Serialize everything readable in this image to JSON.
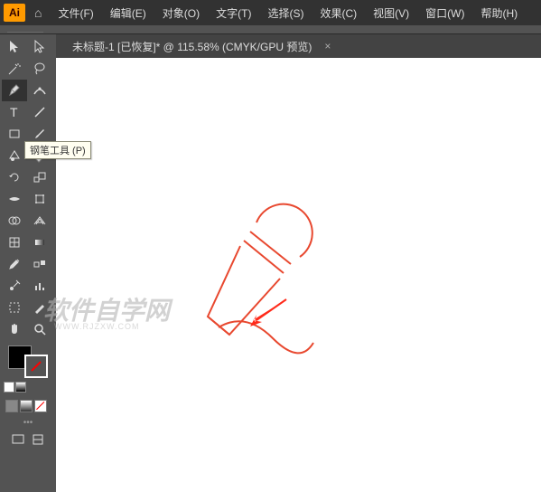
{
  "app": {
    "logo": "Ai"
  },
  "menu": {
    "file": "文件(F)",
    "edit": "编辑(E)",
    "object": "对象(O)",
    "type": "文字(T)",
    "select": "选择(S)",
    "effect": "效果(C)",
    "view": "视图(V)",
    "window": "窗口(W)",
    "help": "帮助(H)"
  },
  "doc": {
    "tab_label": "未标题-1 [已恢复]* @ 115.58%  (CMYK/GPU 预览)",
    "close": "×"
  },
  "tooltip": {
    "pen_tool": "钢笔工具 (P)"
  },
  "watermark": {
    "main": "软件自学网",
    "sub": "WWW.RJZXW.COM"
  },
  "colors": {
    "stroke_drawing": "#e8482f",
    "arrow": "#ff2a1a",
    "fill": "#000000"
  }
}
